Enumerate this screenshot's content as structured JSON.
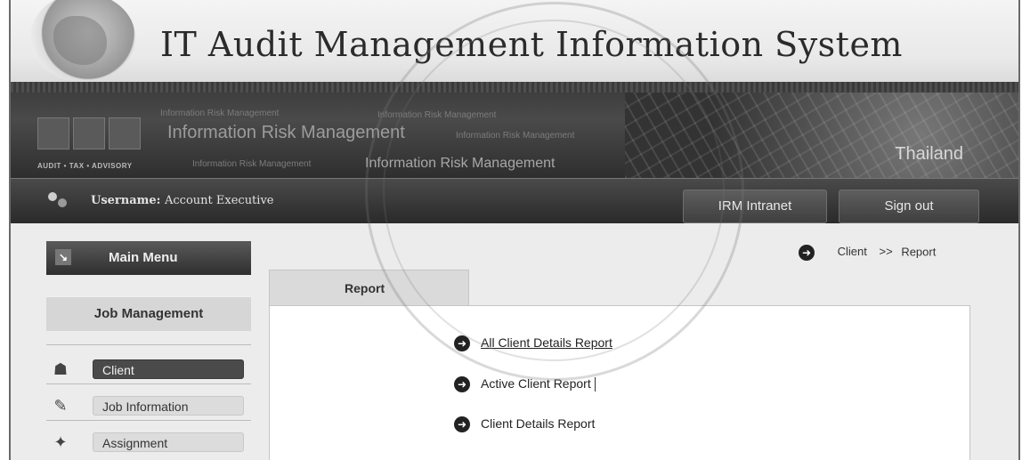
{
  "header": {
    "title": "IT Audit Management Information System"
  },
  "banner": {
    "tagline": "AUDIT • TAX • ADVISORY",
    "ghost_texts": [
      "Information Risk Management",
      "Information Risk Management",
      "Information Risk Management",
      "Information Risk Management",
      "Information Risk Management"
    ],
    "brand_large": "Information Risk Management",
    "brand_mid": "Information Risk Management",
    "country": "Thailand"
  },
  "userbar": {
    "username_label": "Username:",
    "username_value": "Account Executive",
    "intranet_button": "IRM Intranet",
    "signout_button": "Sign out"
  },
  "sidebar": {
    "main_menu": "Main Menu",
    "section_title": "Job Management",
    "items": [
      {
        "label": "Client",
        "icon": "client-icon",
        "active": true
      },
      {
        "label": "Job Information",
        "icon": "job-information-icon",
        "active": false
      },
      {
        "label": "Assignment",
        "icon": "assignment-icon",
        "active": false
      }
    ]
  },
  "breadcrumb": {
    "current": "Client",
    "separator": ">>",
    "page": "Report"
  },
  "main": {
    "tab_label": "Report",
    "reports": [
      {
        "label": "All Client Details Report"
      },
      {
        "label": "Active Client Report"
      },
      {
        "label": "Client Details Report"
      }
    ]
  },
  "colors": {
    "banner_dark": "#3a3a3a",
    "active_item": "#4a4a4a"
  }
}
